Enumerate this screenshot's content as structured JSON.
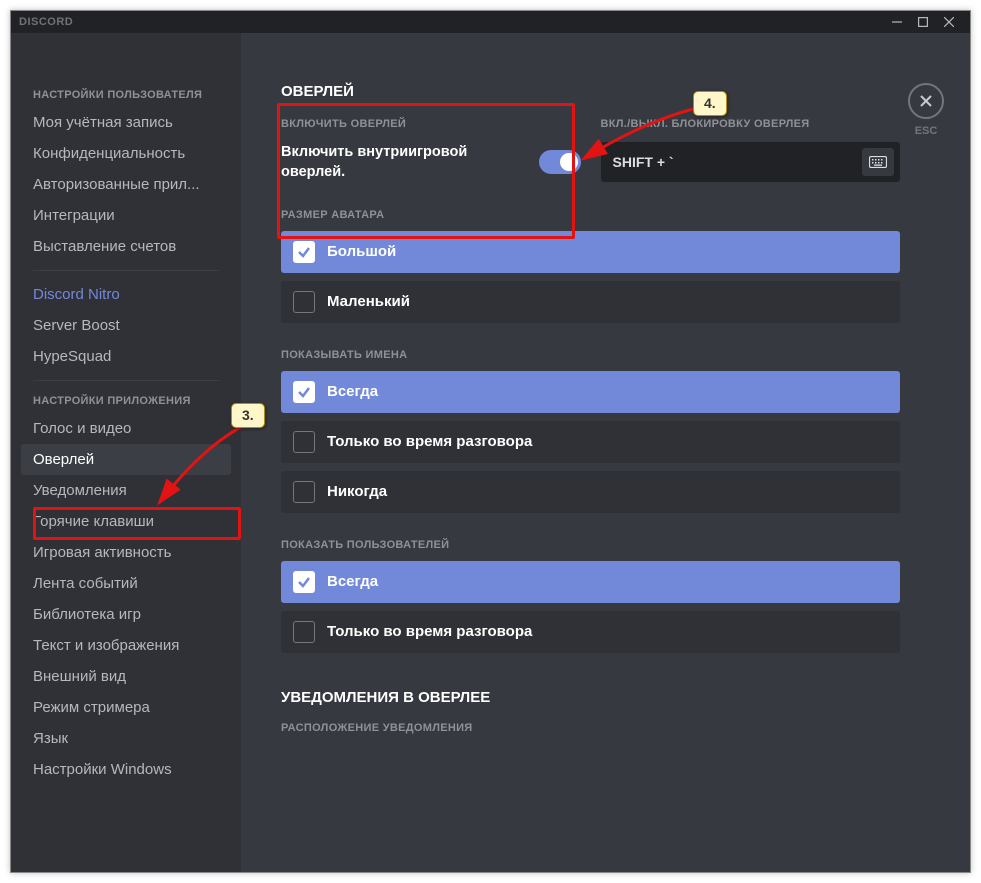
{
  "titlebar": {
    "app_name": "DISCORD"
  },
  "esc": {
    "label": "ESC"
  },
  "sidebar": {
    "header_user": "НАСТРОЙКИ ПОЛЬЗОВАТЕЛЯ",
    "header_app": "НАСТРОЙКИ ПРИЛОЖЕНИЯ",
    "items_user": [
      "Моя учётная запись",
      "Конфиденциальность",
      "Авторизованные прил...",
      "Интеграции",
      "Выставление счетов"
    ],
    "items_nitro": [
      "Discord Nitro",
      "Server Boost",
      "HypeSquad"
    ],
    "items_app": [
      "Голос и видео",
      "Оверлей",
      "Уведомления",
      "Горячие клавиши",
      "Игровая активность",
      "Лента событий",
      "Библиотека игр",
      "Текст и изображения",
      "Внешний вид",
      "Режим стримера",
      "Язык",
      "Настройки Windows"
    ]
  },
  "page": {
    "title": "ОВЕРЛЕЙ",
    "enable_label": "ВКЛЮЧИТЬ ОВЕРЛЕЙ",
    "enable_text": "Включить внутриигровой оверлей.",
    "lock_label": "ВКЛ./ВЫКЛ. БЛОКИРОВКУ ОВЕРЛЕЯ",
    "hotkey": "SHIFT + `",
    "avatar_label": "РАЗМЕР АВАТАРА",
    "avatar_options": [
      "Большой",
      "Маленький"
    ],
    "names_label": "ПОКАЗЫВАТЬ ИМЕНА",
    "names_options": [
      "Всегда",
      "Только во время разговора",
      "Никогда"
    ],
    "users_label": "ПОКАЗАТЬ ПОЛЬЗОВАТЕЛЕЙ",
    "users_options": [
      "Всегда",
      "Только во время разговора"
    ],
    "notif_heading": "УВЕДОМЛЕНИЯ В ОВЕРЛЕЕ",
    "notif_position_label": "РАСПОЛОЖЕНИЕ УВЕДОМЛЕНИЯ"
  },
  "callouts": {
    "c3": "3.",
    "c4": "4."
  }
}
